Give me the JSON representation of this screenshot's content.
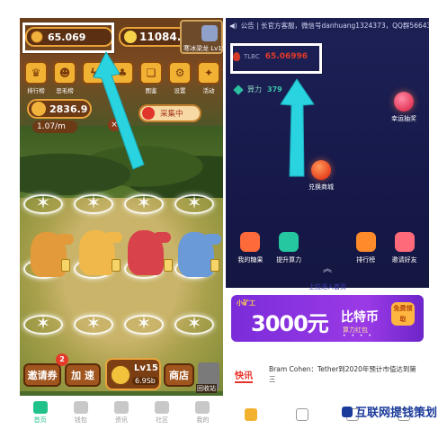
{
  "left_app": {
    "hud": {
      "coin_value": "65.069",
      "gold_value": "11084.2",
      "profile_level": "寒冰梁龙 Lv15"
    },
    "tools": [
      {
        "label": "排行榜",
        "icon": "trophy-icon"
      },
      {
        "label": "恶毛榜",
        "icon": "beard-icon"
      },
      {
        "label": "",
        "icon": "bolt-icon"
      },
      {
        "label": "",
        "icon": "gift-icon"
      },
      {
        "label": "图鉴",
        "icon": "book-icon"
      },
      {
        "label": "设置",
        "icon": "gear-icon"
      },
      {
        "label": "活动",
        "icon": "event-icon"
      }
    ],
    "production": {
      "amount": "2836.9",
      "rate": "1.07/m",
      "mining_label": "采集中"
    },
    "bottom_buttons": {
      "invite": "邀请券",
      "invite_badge": "2",
      "speed": "加 速",
      "level": "Lv15",
      "level_price": "6.9Sb",
      "shop": "商店",
      "recycle": "回收站"
    },
    "tabs": [
      {
        "label": "首页",
        "icon": "home-icon",
        "active": true
      },
      {
        "label": "钱包",
        "icon": "wallet-icon",
        "active": false
      },
      {
        "label": "资讯",
        "icon": "news-icon",
        "active": false
      },
      {
        "label": "社区",
        "icon": "community-icon",
        "active": false
      },
      {
        "label": "我的",
        "icon": "profile-icon",
        "active": false
      }
    ]
  },
  "right_app": {
    "notice": "公告 | 长官方客服，微信号danhuang1324373，QQ群566435216",
    "tlbc": {
      "label": "TLBC",
      "value": "65.06996"
    },
    "power": {
      "label": "算力",
      "value": "379"
    },
    "bubbles": {
      "exchange": "兑换商城",
      "lucky": "幸运抽奖"
    },
    "features": [
      {
        "label": "我的糖果",
        "icon": "candy-icon",
        "color": "#ff6a3a"
      },
      {
        "label": "提升算力",
        "icon": "diamond-icon",
        "color": "#24c7a0"
      },
      {
        "label": "",
        "icon": "chevron-up-icon",
        "color": "#c7c9e8"
      },
      {
        "label": "排行榜",
        "icon": "rank-icon",
        "color": "#ff8a2a"
      },
      {
        "label": "邀请好友",
        "icon": "invite-icon",
        "color": "#ff6a7a"
      }
    ],
    "upload_tip": "上拉进入首页",
    "banner": {
      "brand": "小矿工",
      "amount": "3000元",
      "coin": "比特币",
      "sub": "算力红包",
      "free": "免费领取"
    },
    "news": {
      "tag": "快讯",
      "text": "Bram Cohen：Tether到2020年预计市值达到第三"
    },
    "tabs": [
      {
        "icon": "home-icon",
        "active": true
      },
      {
        "icon": "document-icon",
        "active": false
      },
      {
        "icon": "chat-icon",
        "active": false
      },
      {
        "icon": "profile-icon",
        "active": false
      }
    ]
  },
  "watermark": "互联网提钱策划",
  "colors": {
    "arrow": "#29d3e0",
    "highlight": "#ffffff",
    "accent_green": "#21c28a",
    "tlbc_red": "#e23a2a"
  }
}
